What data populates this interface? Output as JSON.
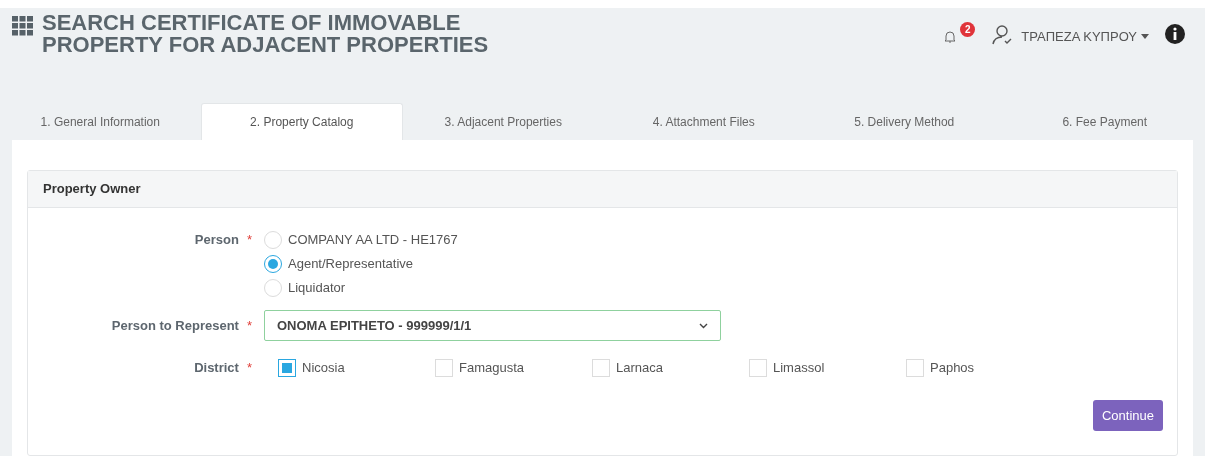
{
  "header": {
    "title_line_1": "SEARCH CERTIFICATE OF IMMOVABLE",
    "title_line_2": "PROPERTY FOR ADJACENT PROPERTIES",
    "notifications": "2",
    "user": "ΤΡΑΠΕΖΑ ΚΥΠΡΟΥ"
  },
  "tabs": [
    {
      "label": "1. General Information",
      "selected": false
    },
    {
      "label": "2. Property Catalog",
      "selected": true
    },
    {
      "label": "3. Adjacent Properties",
      "selected": false
    },
    {
      "label": "4. Attachment Files",
      "selected": false
    },
    {
      "label": "5. Delivery Method",
      "selected": false
    },
    {
      "label": "6. Fee Payment",
      "selected": false
    }
  ],
  "card": {
    "title": "Property Owner",
    "person": {
      "label": "Person",
      "required": "*",
      "options": [
        {
          "label": "COMPANY AA LTD - HE1767",
          "selected": false
        },
        {
          "label": "Agent/Representative",
          "selected": true
        },
        {
          "label": "Liquidator",
          "selected": false
        }
      ]
    },
    "person_to_represent": {
      "label": "Person to Represent",
      "required": "*",
      "value": "ONOMA EPITHETO - 999999/1/1"
    },
    "district": {
      "label": "District",
      "required": "*",
      "options": [
        {
          "label": "Nicosia",
          "checked": true
        },
        {
          "label": "Famagusta",
          "checked": false
        },
        {
          "label": "Larnaca",
          "checked": false
        },
        {
          "label": "Limassol",
          "checked": false
        },
        {
          "label": "Paphos",
          "checked": false
        }
      ]
    },
    "continue_button": "Continue"
  }
}
